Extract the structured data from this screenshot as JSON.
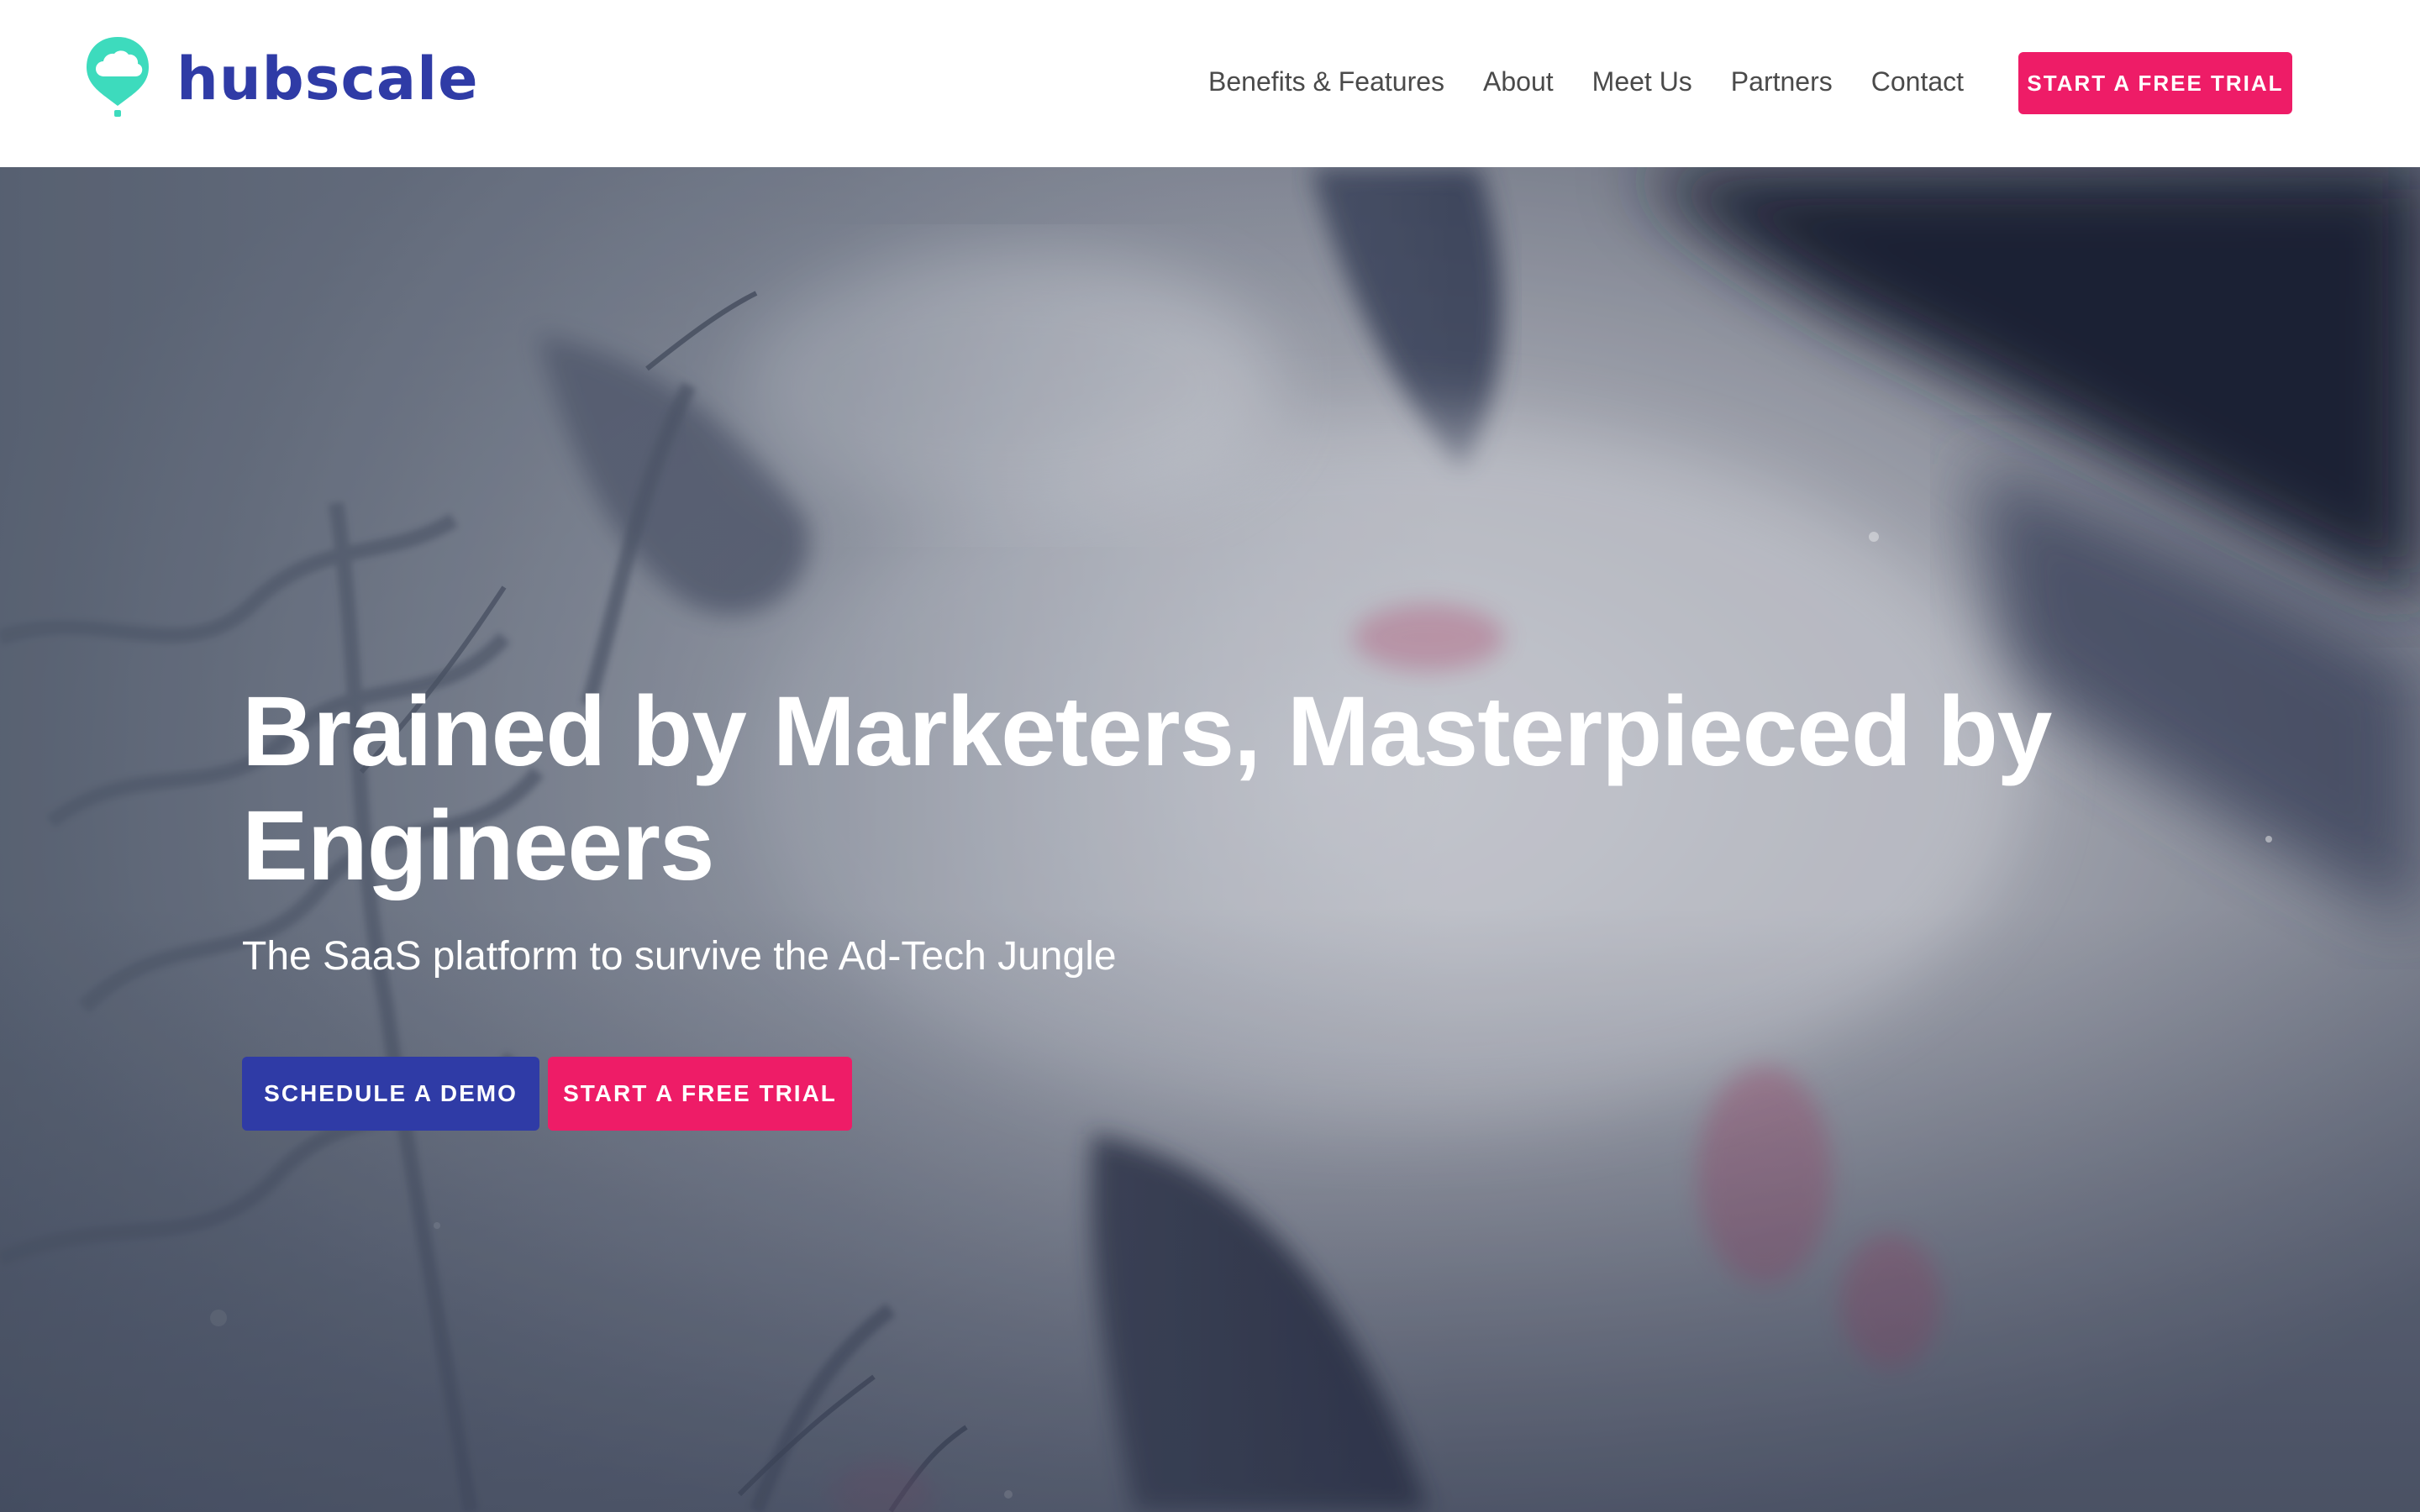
{
  "brand": {
    "name": "hubscale",
    "logo_icon": "cloud-pin-icon",
    "colors": {
      "primary": "#2f3ba6",
      "accent": "#ee1c67",
      "logo_teal": "#3ddbbd"
    }
  },
  "nav": {
    "items": [
      {
        "label": "Benefits & Features"
      },
      {
        "label": "About"
      },
      {
        "label": "Meet Us"
      },
      {
        "label": "Partners"
      },
      {
        "label": "Contact"
      }
    ],
    "cta_label": "START A FREE TRIAL"
  },
  "hero": {
    "title": "Brained by Marketers, Masterpieced by Engineers",
    "subtitle": "The SaaS platform to survive the Ad-Tech Jungle",
    "primary_button": "SCHEDULE A DEMO",
    "secondary_button": "START A FREE TRIAL"
  }
}
